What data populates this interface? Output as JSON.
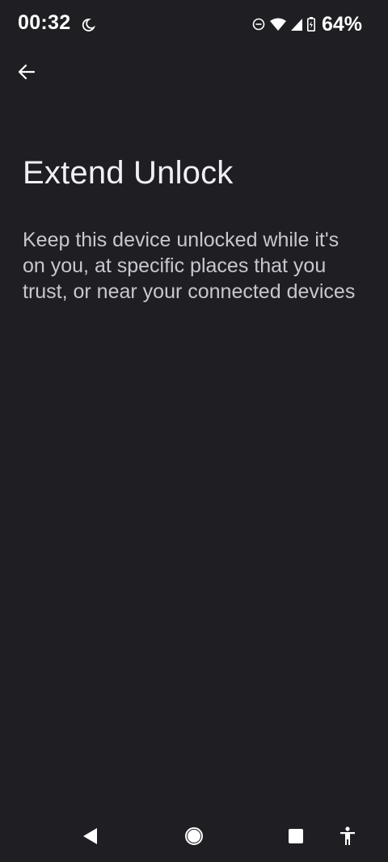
{
  "status_bar": {
    "time": "00:32",
    "battery_percent": "64%",
    "icons": [
      "moon-icon",
      "do-not-disturb-icon",
      "wifi-icon",
      "cell-signal-icon",
      "battery-icon"
    ]
  },
  "app_bar": {
    "back_icon": "arrow-back-icon"
  },
  "content": {
    "title": "Extend Unlock",
    "description": "Keep this device unlocked while it's on you, at specific places that you trust, or near your connected devices"
  },
  "nav_bar": {
    "icons": [
      "nav-back-icon",
      "nav-home-icon",
      "nav-recents-icon",
      "accessibility-icon"
    ]
  },
  "colors": {
    "background": "#1f1f23",
    "title": "#f2f0f4",
    "description": "#c9c6cf",
    "icons": "#ffffff"
  }
}
